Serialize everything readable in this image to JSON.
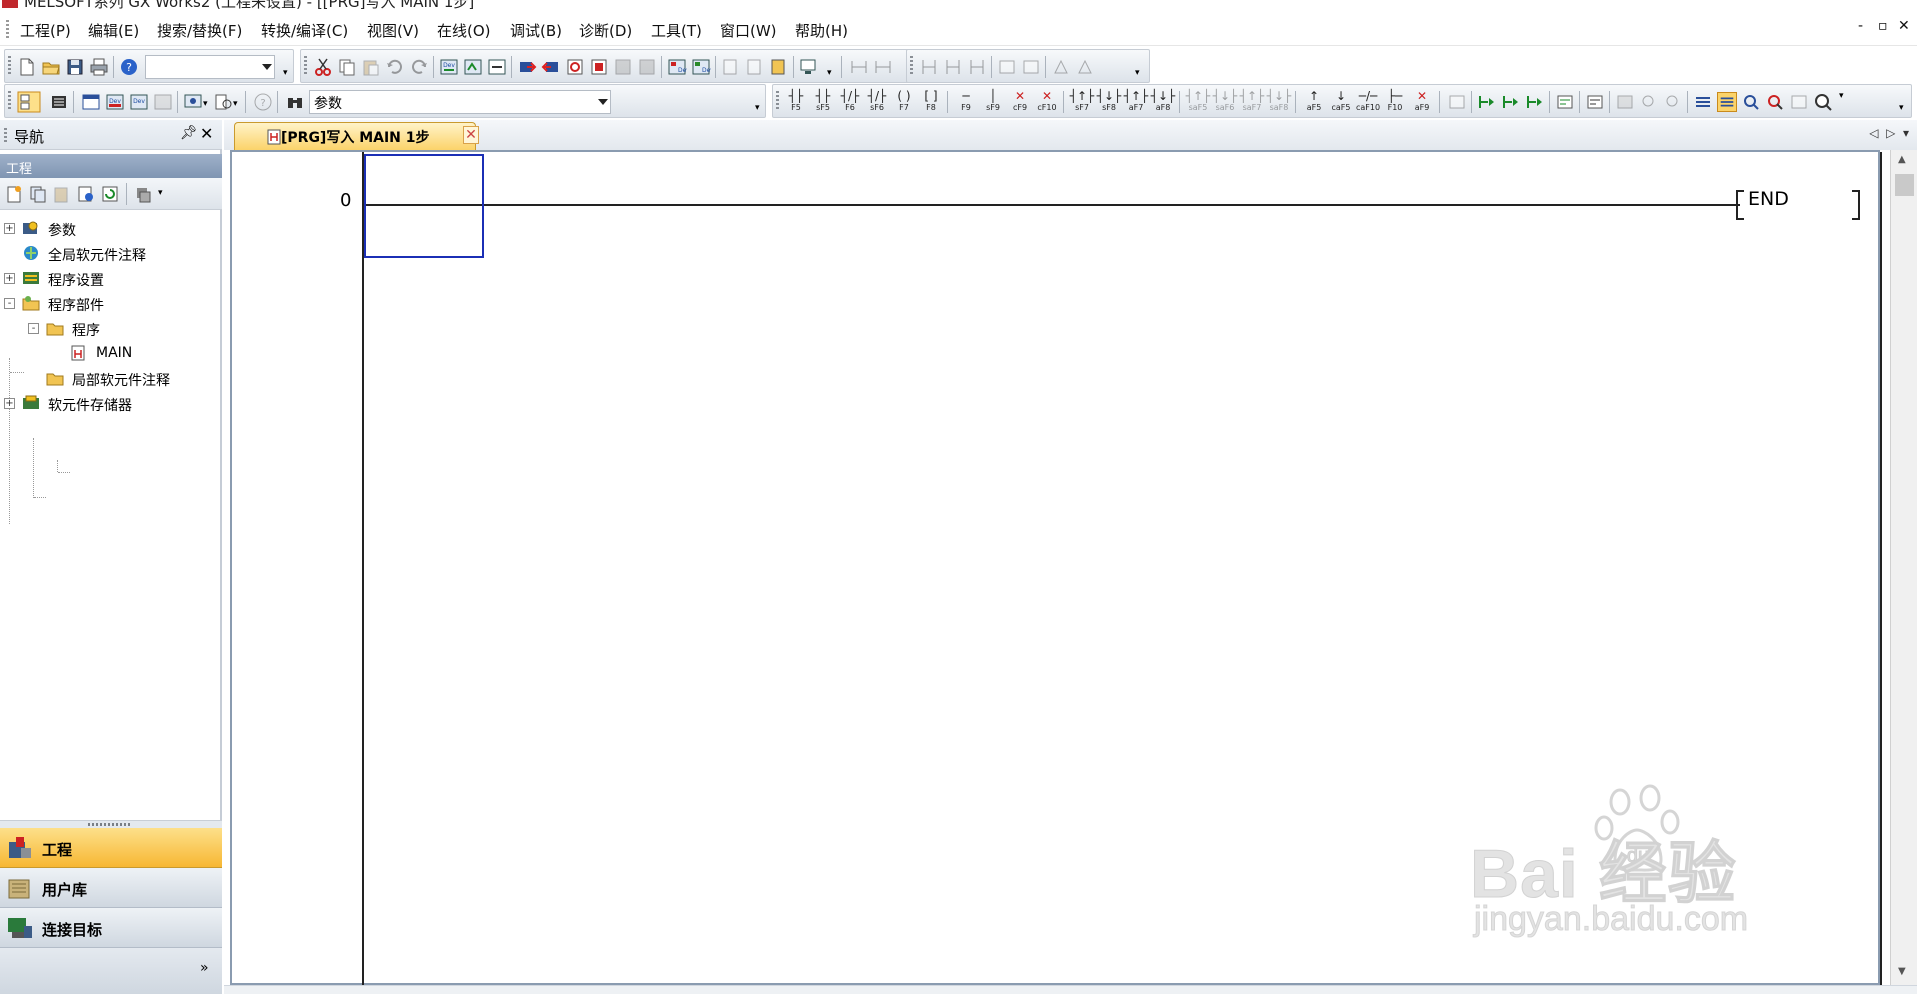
{
  "window": {
    "title": "MELSOFT系列 GX Works2 (工程未设置) - [[PRG]写入 MAIN 1步]"
  },
  "menubar": {
    "items": [
      "工程(P)",
      "编辑(E)",
      "搜索/替换(F)",
      "转换/编译(C)",
      "视图(V)",
      "在线(O)",
      "调试(B)",
      "诊断(D)",
      "工具(T)",
      "窗口(W)",
      "帮助(H)"
    ],
    "window_controls": [
      "-",
      "▫",
      "✕"
    ]
  },
  "toolbar": {
    "search_combo_value": "",
    "param_combo_value": "参数",
    "fkeys": [
      "F5",
      "sF5",
      "F6",
      "sF6",
      "F7",
      "F8",
      "F9",
      "sF9",
      "cF9",
      "cF10",
      "sF7",
      "sF8",
      "aF7",
      "aF8",
      "saF5",
      "saF6",
      "saF7",
      "saF8",
      "aF5",
      "caF5",
      "caF10",
      "F10",
      "aF9"
    ]
  },
  "nav": {
    "title": "导航",
    "section": "工程",
    "tree": [
      {
        "label": "参数",
        "level": 0,
        "expander": "+"
      },
      {
        "label": "全局软元件注释",
        "level": 0,
        "expander": ""
      },
      {
        "label": "程序设置",
        "level": 0,
        "expander": "+"
      },
      {
        "label": "程序部件",
        "level": 0,
        "expander": "-"
      },
      {
        "label": "程序",
        "level": 1,
        "expander": "-"
      },
      {
        "label": "MAIN",
        "level": 2,
        "expander": ""
      },
      {
        "label": "局部软元件注释",
        "level": 1,
        "expander": ""
      },
      {
        "label": "软元件存储器",
        "level": 0,
        "expander": "+"
      }
    ],
    "buttons": {
      "project": "工程",
      "library": "用户库",
      "target": "连接目标"
    },
    "more": "»"
  },
  "tab": {
    "label": "[PRG]写入 MAIN 1步",
    "close": "✕"
  },
  "editor": {
    "step": "0",
    "end_label": "END"
  },
  "watermark": {
    "main": "Bai  经验",
    "du": "du",
    "sub": "jingyan.baidu.com"
  },
  "colors": {
    "tab_active": "#fbd36a",
    "nav_active": "#f7b733",
    "cursor": "#1b2fb5",
    "nav_section": "#8399b6"
  }
}
